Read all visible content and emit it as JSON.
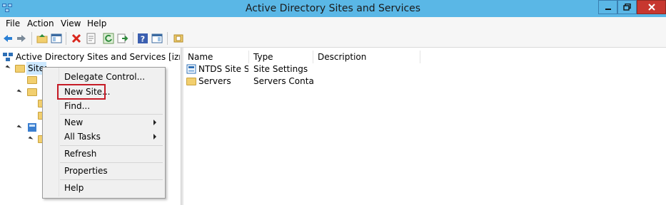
{
  "window": {
    "title": "Active Directory Sites and Services"
  },
  "menu": [
    "File",
    "Action",
    "View",
    "Help"
  ],
  "toolbar_icons": [
    "back-icon",
    "forward-icon",
    "up-folder-icon",
    "console-tree-icon",
    "delete-icon",
    "properties-icon",
    "refresh-icon",
    "export-icon",
    "help-icon",
    "show-hide-icon",
    "snapin-icon"
  ],
  "tree": {
    "root_label": "Active Directory Sites and Services [izmir.hdimd",
    "sites_label": "Sites"
  },
  "list": {
    "columns": [
      "Name",
      "Type",
      "Description"
    ],
    "rows": [
      {
        "name": "NTDS Site Se...",
        "type": "Site Settings",
        "description": ""
      },
      {
        "name": "Servers",
        "type": "Servers Contai...",
        "description": ""
      }
    ]
  },
  "context_menu": {
    "items": [
      "Delegate Control...",
      "New Site...",
      "Find...",
      "New",
      "All Tasks",
      "Refresh",
      "Properties",
      "Help"
    ],
    "highlighted": "New Site..."
  },
  "colors": {
    "titlebar": "#5ab7e6",
    "close": "#c7372f",
    "highlight_border": "#c61b26",
    "menu_bg": "#f0f0f0"
  }
}
